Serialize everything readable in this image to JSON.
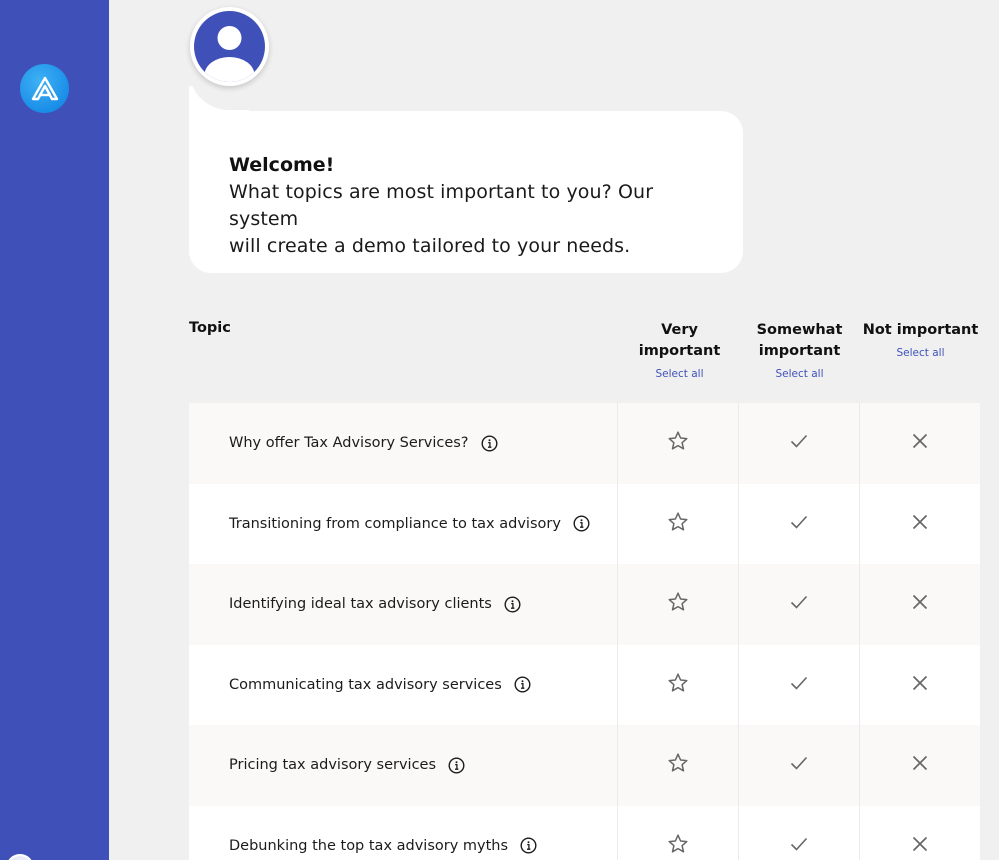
{
  "welcome": {
    "title": "Welcome!",
    "line1": "What topics are most important to you? Our system",
    "line2": "will create a demo tailored to your needs."
  },
  "table": {
    "topic_header": "Topic",
    "columns": [
      {
        "label": "Very important",
        "select_all": "Select all"
      },
      {
        "label_line1": "Somewhat",
        "label_line2": "important",
        "select_all": "Select all"
      },
      {
        "label": "Not important",
        "select_all": "Select all"
      }
    ],
    "rows": [
      {
        "topic": "Why offer Tax Advisory Services?"
      },
      {
        "topic": "Transitioning from compliance to tax advisory"
      },
      {
        "topic": "Identifying ideal tax advisory clients"
      },
      {
        "topic": "Communicating tax advisory services"
      },
      {
        "topic": "Pricing tax advisory services"
      },
      {
        "topic": "Debunking the top tax advisory myths"
      }
    ]
  },
  "icons": {
    "logo": "brand-logo-icon",
    "avatar": "user-avatar-icon",
    "info": "info-icon",
    "star": "star-icon",
    "check": "check-icon",
    "x": "close-icon"
  },
  "colors": {
    "sidebar": "#3f51b8",
    "accent": "#3f51b8",
    "logo": "#1a8ee8",
    "page_bg": "#f0f0f0"
  }
}
